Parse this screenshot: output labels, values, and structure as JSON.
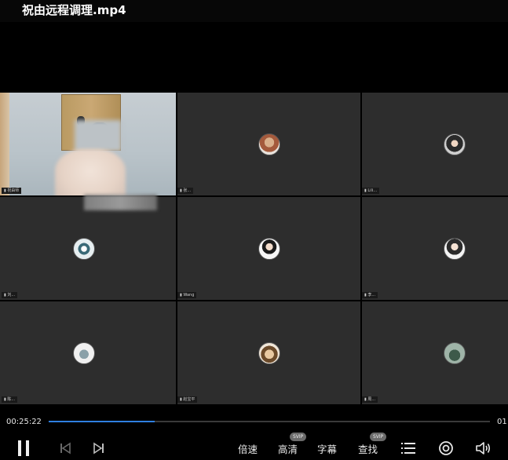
{
  "window": {
    "title": "祝由远程调理.mp4"
  },
  "meeting": {
    "tiles": [
      {
        "label": "▮ 祝由师",
        "avatar": "camera-feed"
      },
      {
        "label": "▮ 张...",
        "avatar": "avatar-photo"
      },
      {
        "label": "▮ Lili...",
        "avatar": "avatar-photo"
      },
      {
        "label": "▮ 刘...",
        "avatar": "avatar-photo"
      },
      {
        "label": "▮ Wang",
        "avatar": "avatar-photo"
      },
      {
        "label": "▮ 李...",
        "avatar": "avatar-photo"
      },
      {
        "label": "▮ 陈...",
        "avatar": "avatar-photo"
      },
      {
        "label": "▮ 赵宝平",
        "avatar": "avatar-photo"
      },
      {
        "label": "▮ 周...",
        "avatar": "avatar-photo"
      }
    ]
  },
  "controls": {
    "current_time": "00:25:22",
    "total_time": "01",
    "progress_fraction": 0.24,
    "speed_label": "倍速",
    "quality_label": "高清",
    "quality_badge": "SVIP",
    "subtitle_label": "字幕",
    "search_label": "查找",
    "search_badge": "SVIP"
  },
  "icons": {
    "pause": "pause-icon",
    "prev": "skip-previous-icon",
    "next": "skip-next-icon",
    "list": "playlist-icon",
    "settings": "settings-icon",
    "volume": "volume-icon"
  },
  "colors": {
    "progress": "#2f7fe0",
    "tile_bg": "#2d2d2d",
    "background": "#000000"
  }
}
